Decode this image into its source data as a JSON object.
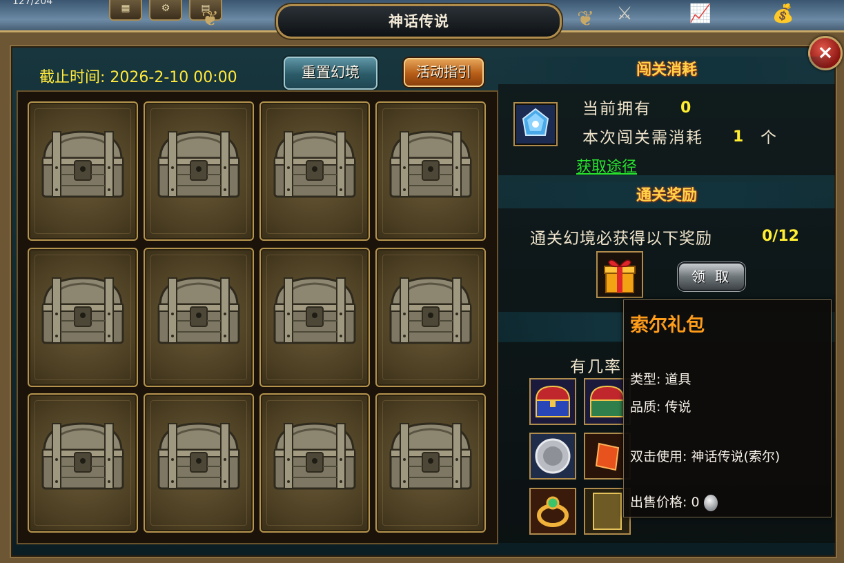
{
  "hud": {
    "counter": "127/204",
    "buttons": [
      "▦",
      "⚙",
      "▤"
    ],
    "decor_icons": [
      "☘",
      "⚔",
      "📈",
      "💰"
    ]
  },
  "window": {
    "title": "神话传说",
    "close_label": "×"
  },
  "toolbar": {
    "deadline": "截止时间: 2026-2-10 00:00",
    "reset_label": "重置幻境",
    "guide_label": "活动指引"
  },
  "grid": {
    "rows": 3,
    "cols": 4,
    "chest_count": 12
  },
  "cost": {
    "header": "闯关消耗",
    "owned_label": "当前拥有",
    "owned_value": "0",
    "need_label": "本次闯关需消耗",
    "need_value": "1",
    "unit": "个",
    "get_link": "获取途径"
  },
  "reward": {
    "header": "通关奖励",
    "desc": "通关幻境必获得以下奖励",
    "progress": "0/12",
    "claim_label": "领 取"
  },
  "pool": {
    "header": "",
    "text_visible": "有几率"
  },
  "tooltip": {
    "name": "索尔礼包",
    "type_line": "类型: 道具",
    "quality_line": "品质: 传说",
    "use_line": "双击使用: 神话传说(索尔)",
    "price_line": "出售价格:  0"
  },
  "colors": {
    "accent_yellow": "#ffee32",
    "link_green": "#27e52e",
    "tooltip_title": "#ff9c1a",
    "frame_gold": "#b08d4d"
  }
}
